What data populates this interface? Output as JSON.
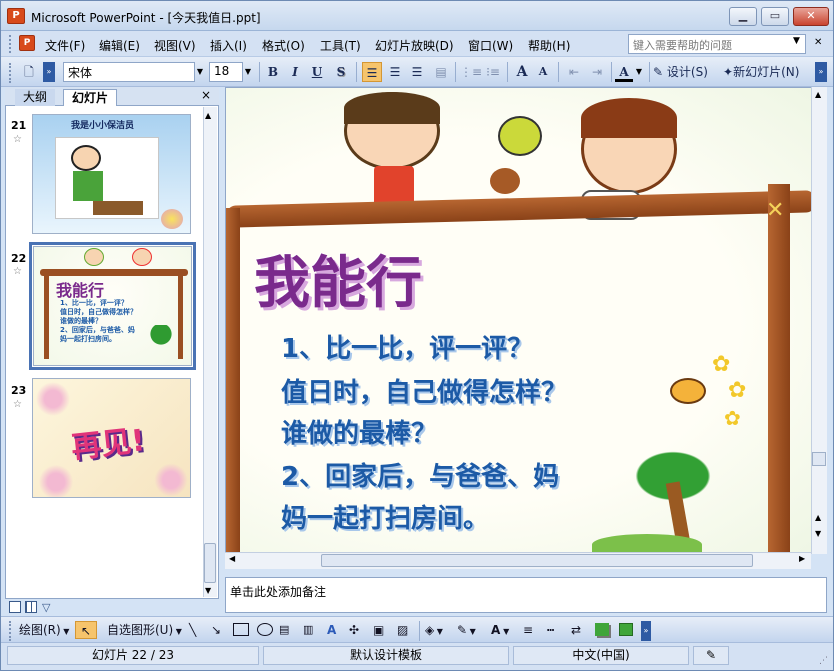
{
  "window": {
    "title": "Microsoft PowerPoint - [今天我值日.ppt]",
    "app_icon_text": "P",
    "controls": [
      "minimize",
      "restore",
      "close"
    ]
  },
  "menu": {
    "items": [
      "文件(F)",
      "编辑(E)",
      "视图(V)",
      "插入(I)",
      "格式(O)",
      "工具(T)",
      "幻灯片放映(D)",
      "窗口(W)",
      "帮助(H)"
    ],
    "help_placeholder": "键入需要帮助的问题"
  },
  "toolbar": {
    "font_name": "宋体",
    "font_size": "18",
    "bold": "B",
    "italic": "I",
    "underline": "U",
    "shadow": "S",
    "grow_font": "A",
    "shrink_font": "A",
    "font_color": "A",
    "design_label": "设计(S)",
    "new_slide_label": "新幻灯片(N)"
  },
  "outline_panel": {
    "tabs": [
      "大纲",
      "幻灯片"
    ],
    "close": "×",
    "slides": [
      {
        "number": "21",
        "star": "☆",
        "caption": "我是小小保洁员"
      },
      {
        "number": "22",
        "star": "☆",
        "caption": "我能行"
      },
      {
        "number": "23",
        "star": "☆",
        "caption": "再见!"
      }
    ],
    "thumb22_lines": [
      "1、比一比，评一评？",
      "值日时，自己做得怎样？",
      "谁做的最棒？",
      "2、回家后，与爸爸、妈",
      "妈一起打扫房间。"
    ]
  },
  "slide": {
    "title": "我能行",
    "lines": [
      "1、比一比，评一评？",
      "值日时，自己做得怎样？",
      "谁做的最棒？",
      "2、回家后，与爸爸、妈",
      "妈一起打扫房间。"
    ]
  },
  "notes": {
    "placeholder": "单击此处添加备注"
  },
  "drawing_toolbar": {
    "draw_label": "绘图(R)",
    "autoshapes_label": "自选图形(U)"
  },
  "statusbar": {
    "slide_position": "幻灯片 22 / 23",
    "template": "默认设计模板",
    "language": "中文(中国)"
  },
  "colors": {
    "accent": "#4a73b4",
    "slide_title": "#7a2a8c",
    "slide_text": "#1c5aa6"
  }
}
